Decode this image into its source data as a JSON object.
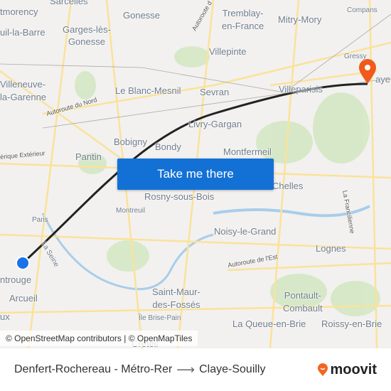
{
  "map": {
    "labels": [
      "Sarcelles",
      "tmorency",
      "Gonesse",
      "Tremblay-\nen-France",
      "Mitry-Mory",
      "Compans",
      "uil-la-Barre",
      "Garges-lès-\nGonesse",
      "Villepinte",
      "Gressy",
      "Villeneuve-\nla-Garenne",
      "Le Blanc-Mesnil",
      "Sevran",
      "Villeparisis",
      "aye-S",
      "Autoroute du Nord",
      "Livry-Gargan",
      "Bobigny",
      "Bondy",
      "Montfermeil",
      "érique Extérieur",
      "Pantin",
      "Chelles",
      "Paris",
      "Montreuil",
      "Rosny-sous-Bois",
      "La Francilienne",
      "Noisy-le-Grand",
      "Lognes",
      "La Seine",
      "Autoroute de l'Est",
      "ntrouge",
      "Arcueil",
      "Saint-Maur-\ndes-Fossés",
      "Pontault-\nCombault",
      "Île Brise-Pain",
      "ux",
      "La Queue-en-Brie",
      "Roissy-en-Brie",
      "Créteil",
      "Autoroute d"
    ],
    "origin_marker_color": "#1a73e8",
    "destination_marker_color": "#f05a1a",
    "route_color": "#222222"
  },
  "cta": {
    "label": "Take me there"
  },
  "attribution": "© OpenStreetMap contributors | © OpenMapTiles",
  "footer": {
    "origin": "Denfert-Rochereau - Métro-Rer",
    "arrow": "⟶",
    "destination": "Claye-Souilly",
    "brand": "moovit"
  }
}
